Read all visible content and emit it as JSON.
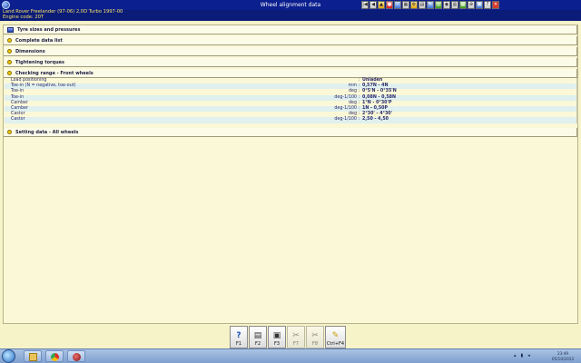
{
  "window": {
    "title": "Wheel alignment data"
  },
  "vehicle": {
    "line1": "Land Rover   Freelander (97-06) 2,0D Turbo 1997-00",
    "line2": "Engine code: 20T"
  },
  "toolbar": {
    "icons": [
      "first-icon",
      "prev-icon",
      "warning-icon",
      "stop-icon",
      "info-icon",
      "tool-icon",
      "wrench-icon",
      "data-icon",
      "tools-icon",
      "gauge-icon",
      "eye-icon",
      "print-icon",
      "calc-icon",
      "wheel-icon",
      "settings-icon",
      "help-icon",
      "close-icon"
    ],
    "glyphs": [
      "|◀",
      "◀",
      "▲",
      "●",
      "i",
      "▦",
      "⚙",
      "▤",
      "✎",
      "◎",
      "◉",
      "▥",
      "▦",
      "⊕",
      "▣",
      "?",
      "✕"
    ]
  },
  "sections": [
    {
      "label": "Tyre sizes and pressures",
      "icon": "tyre-icon"
    },
    {
      "label": "Complete data list",
      "icon": "expand-icon"
    },
    {
      "label": "Dimensions",
      "icon": "expand-icon"
    },
    {
      "label": "Tightening torques",
      "icon": "expand-icon"
    },
    {
      "label": "Checking range - Front wheels",
      "icon": "expand-icon"
    },
    {
      "label": "Setting data - All wheels",
      "icon": "expand-icon"
    }
  ],
  "rows": [
    {
      "label": "Load positioning",
      "unit": "",
      "value": "Unladen"
    },
    {
      "label": "Toe-in (N = negative, toe-out)",
      "unit": "mm",
      "value": "0,57N - 4N"
    },
    {
      "label": "Toe-in",
      "unit": "deg",
      "value": "0°5'N - 0°35'N"
    },
    {
      "label": "Toe-in",
      "unit": "deg-1/100",
      "value": "0,08N - 0,58N"
    },
    {
      "label": "Camber",
      "unit": "deg",
      "value": "1°N - 0°30'P"
    },
    {
      "label": "Camber",
      "unit": "deg-1/100",
      "value": "1N - 0,50P"
    },
    {
      "label": "Castor",
      "unit": "deg",
      "value": "2°30' - 4°30'"
    },
    {
      "label": "Castor",
      "unit": "deg-1/100",
      "value": "2,50 - 4,50"
    }
  ],
  "function_keys": [
    {
      "label": "F1",
      "icon": "help-icon",
      "glyph": "?"
    },
    {
      "label": "F2",
      "icon": "print-icon",
      "glyph": "▤"
    },
    {
      "label": "F3",
      "icon": "manual-icon",
      "glyph": "▣"
    },
    {
      "label": "F7",
      "icon": "tools-disabled-icon",
      "glyph": "✂"
    },
    {
      "label": "F8",
      "icon": "tools2-disabled-icon",
      "glyph": "✂"
    },
    {
      "label": "Ctrl+F4",
      "icon": "exit-icon",
      "glyph": "✎"
    }
  ],
  "taskbar": {
    "time": "23:49",
    "date": "05/10/2013"
  },
  "colors": {
    "titlebar": "#0b1f8e",
    "vehicle_text": "#f5e36a",
    "background": "#f7f3c8",
    "row_alt": "#dff0ef"
  }
}
